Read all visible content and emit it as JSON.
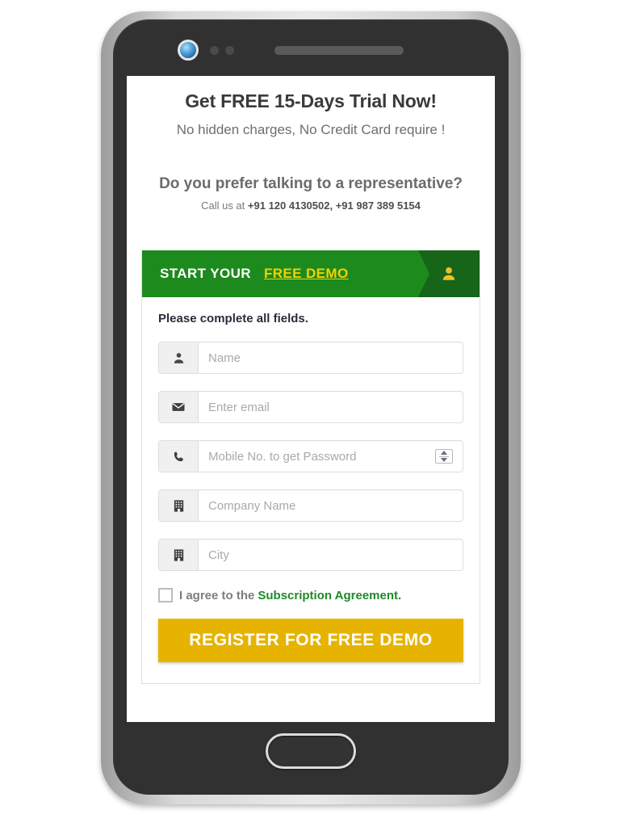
{
  "colors": {
    "banner_green": "#1d8a1e",
    "banner_green_dark": "#176519",
    "accent_yellow": "#f4d000",
    "button_amber": "#e6b400",
    "link_green": "#1f8a28"
  },
  "page": {
    "headline": "Get FREE 15-Days Trial Now!",
    "subheadline": "No hidden charges, No Credit Card require !",
    "question": "Do you prefer talking to a representative?",
    "call_label": "Call us at",
    "phone_numbers": "+91 120 4130502, +91 987 389 5154"
  },
  "form": {
    "banner_title": "START YOUR",
    "banner_link": "FREE DEMO",
    "banner_icon": "user-icon",
    "note": "Please complete all fields.",
    "fields": [
      {
        "name": "name",
        "icon": "user-icon",
        "placeholder": "Name",
        "value": "",
        "spinner": false
      },
      {
        "name": "email",
        "icon": "envelope-icon",
        "placeholder": "Enter email",
        "value": "",
        "spinner": false
      },
      {
        "name": "mobile",
        "icon": "phone-icon",
        "placeholder": "Mobile No. to get Password",
        "value": "",
        "spinner": true
      },
      {
        "name": "company",
        "icon": "building-icon",
        "placeholder": "Company Name",
        "value": "",
        "spinner": false
      },
      {
        "name": "city",
        "icon": "building-icon",
        "placeholder": "City",
        "value": "",
        "spinner": false
      }
    ],
    "agree_text": "I agree to the",
    "agree_link": "Subscription Agreement.",
    "agree_checked": false,
    "submit_label": "REGISTER FOR FREE DEMO"
  },
  "device": {
    "camera": "camera-lens",
    "speaker": "speaker-grille",
    "home": "home-button"
  }
}
